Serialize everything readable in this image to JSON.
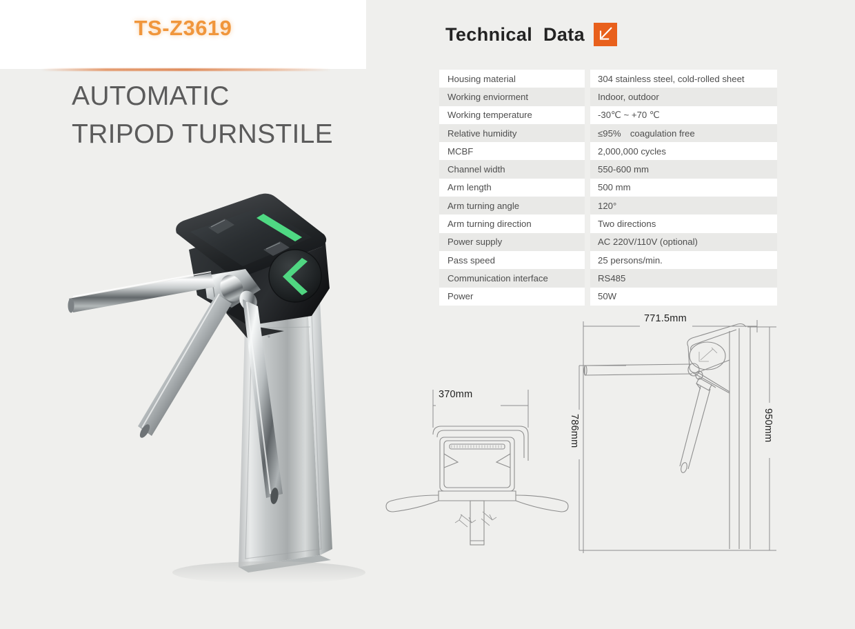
{
  "header": {
    "model_code": "TS-Z3619",
    "product_title_line1": "AUTOMATIC",
    "product_title_line2": "TRIPOD TURNSTILE",
    "accent_color": "#f0963c"
  },
  "tech_section": {
    "heading": "Technical  Data",
    "icon": "arrow-down-left-icon",
    "icon_color": "#e8601c"
  },
  "spec_table": {
    "rows": [
      {
        "label": "Housing material",
        "value": "304 stainless steel, cold-rolled sheet"
      },
      {
        "label": "Working enviorment",
        "value": "Indoor, outdoor"
      },
      {
        "label": "Working temperature",
        "value": "-30℃ ~ +70 ℃"
      },
      {
        "label": "Relative humidity",
        "value": "≤95% coagulation free"
      },
      {
        "label": "MCBF",
        "value": "2,000,000 cycles"
      },
      {
        "label": "Channel width",
        "value": "550-600 mm"
      },
      {
        "label": "Arm length",
        "value": "500 mm"
      },
      {
        "label": "Arm turning angle",
        "value": "120°"
      },
      {
        "label": "Arm turning direction",
        "value": "Two directions"
      },
      {
        "label": "Power supply",
        "value": "AC 220V/110V (optional)"
      },
      {
        "label": "Pass speed",
        "value": "25 persons/min."
      },
      {
        "label": "Communication interface",
        "value": "RS485"
      },
      {
        "label": "Power",
        "value": "50W"
      }
    ]
  },
  "drawings": {
    "front_view": {
      "name": "front-view-drawing",
      "width_label": "370mm"
    },
    "side_view": {
      "name": "side-view-drawing",
      "width_label": "771.5mm",
      "arm_height_label": "786mm",
      "total_height_label": "950mm"
    }
  },
  "product_photo": {
    "name": "tripod-turnstile-photo",
    "led_indicator": "green-left-arrow",
    "led_color": "#2fd26a"
  }
}
